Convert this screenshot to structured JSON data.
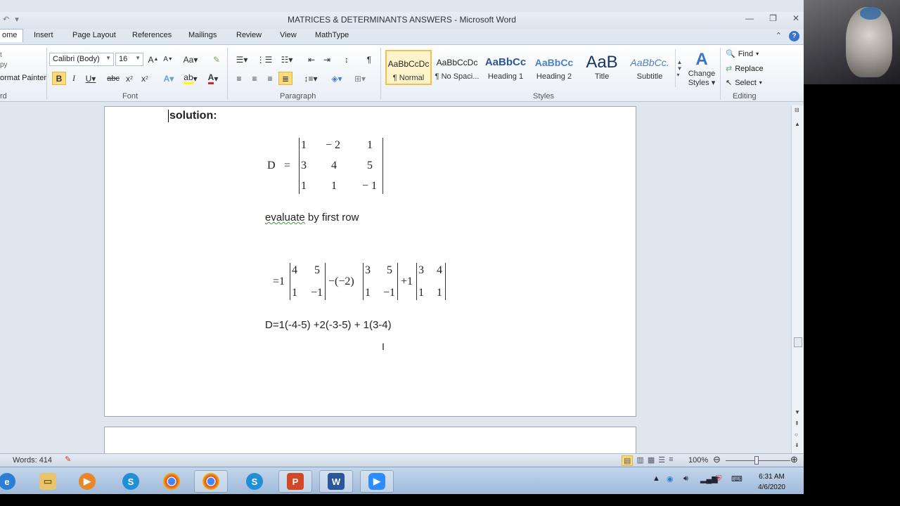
{
  "window": {
    "title": "MATRICES & DETERMINANTS ANSWERS  -  Microsoft Word"
  },
  "tabs": [
    "ome",
    "Insert",
    "Page Layout",
    "References",
    "Mailings",
    "Review",
    "View",
    "MathType"
  ],
  "clipboard": {
    "cut_label": "t",
    "copy_label": "py",
    "painter_label": "ormat Painter",
    "group_label": "rd"
  },
  "font": {
    "name": "Calibri (Body)",
    "size": "16",
    "group_label": "Font"
  },
  "paragraph": {
    "group_label": "Paragraph"
  },
  "styles": {
    "group_label": "Styles",
    "items": [
      {
        "sample": "AaBbCcDc",
        "name": "¶ Normal"
      },
      {
        "sample": "AaBbCcDc",
        "name": "¶ No Spaci..."
      },
      {
        "sample": "AaBbCс",
        "name": "Heading 1"
      },
      {
        "sample": "AaBbCc",
        "name": "Heading 2"
      },
      {
        "sample": "AaB",
        "name": "Title"
      },
      {
        "sample": "AaBbCc.",
        "name": "Subtitle"
      }
    ],
    "change_label_1": "Change",
    "change_label_2": "Styles"
  },
  "editing": {
    "find": "Find",
    "replace": "Replace",
    "select": "Select",
    "group_label": "Editing"
  },
  "document": {
    "heading": "solution:",
    "det_label": "D",
    "eq": "=",
    "matrix": [
      [
        "1",
        "− 2",
        "1"
      ],
      [
        "3",
        "4",
        "5"
      ],
      [
        "1",
        "1",
        "− 1"
      ]
    ],
    "evaluate_word": "evaluate",
    "evaluate_rest": " by first row",
    "expansion": {
      "lead": "=1",
      "m1": [
        [
          "4",
          "5"
        ],
        [
          "1",
          "−1"
        ]
      ],
      "coef2": "−(−2)",
      "m2": [
        [
          "3",
          "5"
        ],
        [
          "1",
          "−1"
        ]
      ],
      "coef3": "+1",
      "m3": [
        [
          "3",
          "4"
        ],
        [
          "1",
          "1"
        ]
      ]
    },
    "result_line": "D=1(-4-5) +2(-3-5) + 1(3-4)"
  },
  "status": {
    "words": "Words: 414",
    "zoom": "100%"
  },
  "clock": {
    "time": "6:31 AM",
    "date": "4/6/2020"
  },
  "taskbar_icons": [
    "ie-icon",
    "explorer-icon",
    "media-player-icon",
    "skype-icon",
    "chrome-icon",
    "chrome-icon-2",
    "skype-icon-2",
    "powerpoint-icon",
    "word-icon",
    "zoom-icon"
  ]
}
